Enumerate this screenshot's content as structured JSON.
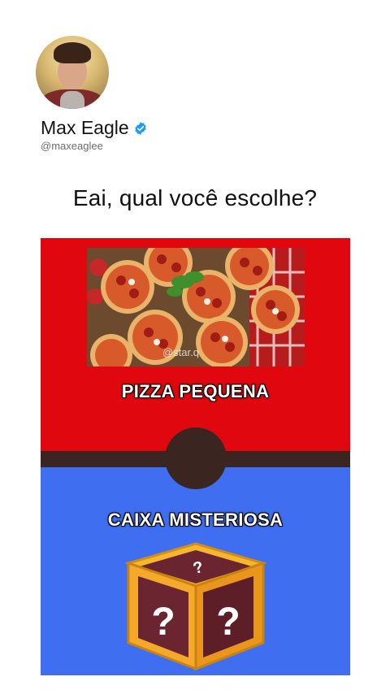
{
  "post": {
    "author_name": "Max Eagle",
    "author_handle": "@maxeaglee",
    "verified_icon": "verified-badge-icon",
    "text": "Eai, qual você escolhe?"
  },
  "card": {
    "option_top_label": "PIZZA PEQUENA",
    "option_bottom_label": "CAIXA MISTERIOSA",
    "watermark": "@star.q",
    "colors": {
      "top": "#e0080e",
      "band": "#3a2520",
      "bottom": "#3f6ff0"
    }
  }
}
